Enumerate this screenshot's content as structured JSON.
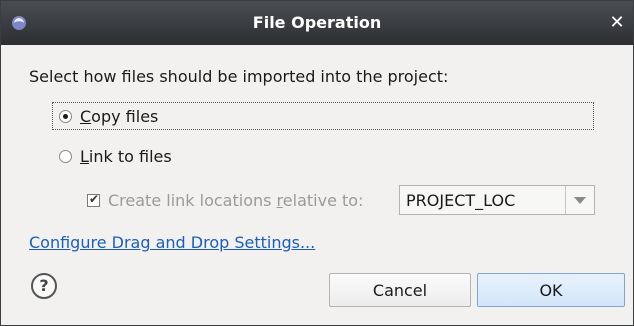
{
  "window": {
    "title": "File Operation",
    "close_glyph": "✕",
    "icons": {
      "app": "eclipse-app-icon",
      "close": "close-icon",
      "help": "help-icon"
    }
  },
  "prompt": "Select how files should be imported into the project:",
  "options": {
    "copy": {
      "label_mnemonic": "C",
      "label_rest": "opy files",
      "selected": true
    },
    "link": {
      "label_mnemonic": "L",
      "label_rest": "ink to files",
      "selected": false
    }
  },
  "relative": {
    "checked": true,
    "enabled": false,
    "label_pre": "Create link locations ",
    "label_mnemonic": "r",
    "label_post": "elative to:",
    "combo_value": "PROJECT_LOC"
  },
  "config_link": "Configure Drag and Drop Settings...",
  "help_glyph": "?",
  "buttons": {
    "cancel": "Cancel",
    "ok": "OK"
  },
  "colors": {
    "link": "#1c5fb4",
    "titlebar": "#2c2e32",
    "disabled_text": "#9a9a9a"
  }
}
